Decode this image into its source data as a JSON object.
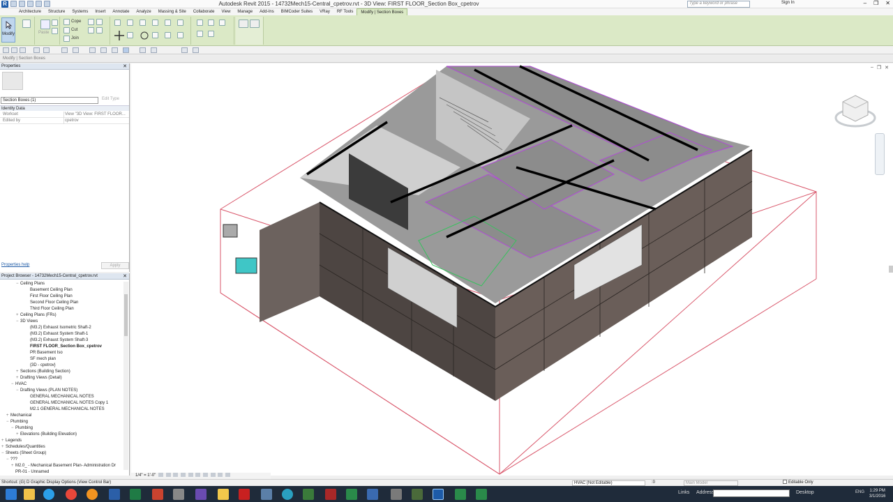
{
  "app": {
    "title": "Autodesk Revit 2015 -     14732Mech15-Central_cpetrov.rvt - 3D View: FIRST FLOOR_Section Box_cpetrov",
    "search_placeholder": "Type a keyword or phrase",
    "sign_in": "Sign In"
  },
  "ribbon": {
    "tabs": [
      "Architecture",
      "Structure",
      "Systems",
      "Insert",
      "Annotate",
      "Analyze",
      "Massing & Site",
      "Collaborate",
      "View",
      "Manage",
      "Add-Ins",
      "BIMCoder Suites",
      "VRay",
      "RF Tools",
      "Modify | Section Boxes"
    ],
    "active_tab": "Modify | Section Boxes",
    "modify_label": "Modify",
    "paste_label": "Paste",
    "cope_label": "Cope",
    "cut_label": "Cut",
    "join_label": "Join"
  },
  "context_bar": {
    "label": "Modify | Section Boxes"
  },
  "properties": {
    "header": "Properties",
    "selector": "Section Boxes (1)",
    "edit_type": "Edit Type",
    "group": "Identity Data",
    "rows": [
      {
        "key": "Workset",
        "value": "View \"3D View: FIRST FLOOR..."
      },
      {
        "key": "Edited by",
        "value": "cpetrov"
      }
    ],
    "help_link": "Properties help",
    "apply": "Apply"
  },
  "browser": {
    "header": "Project Browser - 14732Mech15-Central_cpetrov.rvt",
    "nodes": [
      {
        "label": "Ceiling Plans",
        "indent": 3,
        "toggle": "−"
      },
      {
        "label": "Basement Ceiling Plan",
        "indent": 5,
        "toggle": ""
      },
      {
        "label": "First Floor Ceiling Plan",
        "indent": 5,
        "toggle": ""
      },
      {
        "label": "Second Floor Ceiling Plan",
        "indent": 5,
        "toggle": ""
      },
      {
        "label": "Third Floor Ceiling Plan",
        "indent": 5,
        "toggle": ""
      },
      {
        "label": "Ceiling Plans (FRs)",
        "indent": 3,
        "toggle": "+"
      },
      {
        "label": "3D Views",
        "indent": 3,
        "toggle": "−"
      },
      {
        "label": "(M3.2) Exhaust Isometric Shaft-2",
        "indent": 5,
        "toggle": ""
      },
      {
        "label": "(M3.2) Exhaust System Shaft-1",
        "indent": 5,
        "toggle": ""
      },
      {
        "label": "(M3.2) Exhaust System Shaft-3",
        "indent": 5,
        "toggle": ""
      },
      {
        "label": "FIRST FLOOR_Section Box_cpetrov",
        "indent": 5,
        "toggle": "",
        "selected": true
      },
      {
        "label": "PR Basement Iso",
        "indent": 5,
        "toggle": ""
      },
      {
        "label": "SF mech plan",
        "indent": 5,
        "toggle": ""
      },
      {
        "label": "{3D - cpetrov}",
        "indent": 5,
        "toggle": ""
      },
      {
        "label": "Sections (Building Section)",
        "indent": 3,
        "toggle": "+"
      },
      {
        "label": "Drafting Views (Detail)",
        "indent": 3,
        "toggle": "+"
      },
      {
        "label": "HVAC",
        "indent": 2,
        "toggle": "−"
      },
      {
        "label": "Drafting Views (PLAN NOTES)",
        "indent": 3,
        "toggle": "−"
      },
      {
        "label": "GENERAL MECHANICAL NOTES",
        "indent": 5,
        "toggle": ""
      },
      {
        "label": "GENERAL MECHANICAL NOTES Copy 1",
        "indent": 5,
        "toggle": ""
      },
      {
        "label": "M2.1 GENERAL MECHANICAL NOTES",
        "indent": 5,
        "toggle": ""
      },
      {
        "label": "Mechanical",
        "indent": 1,
        "toggle": "+"
      },
      {
        "label": "Plumbing",
        "indent": 1,
        "toggle": "−"
      },
      {
        "label": "Plumbing",
        "indent": 2,
        "toggle": "−"
      },
      {
        "label": "Elevations (Building Elevation)",
        "indent": 3,
        "toggle": "+"
      },
      {
        "label": "Legends",
        "indent": 0,
        "toggle": "+"
      },
      {
        "label": "Schedules/Quantities",
        "indent": 0,
        "toggle": "+"
      },
      {
        "label": "Sheets (Sheet Group)",
        "indent": 0,
        "toggle": "−"
      },
      {
        "label": "???",
        "indent": 1,
        "toggle": "−"
      },
      {
        "label": "M2.0_ - Mechanical Basement Plan- Administration Dr",
        "indent": 2,
        "toggle": "+"
      },
      {
        "label": "PR-01 - Unnamed",
        "indent": 2,
        "toggle": ""
      }
    ]
  },
  "view_control": {
    "scale": "1/4\" = 1'-0\""
  },
  "status": {
    "text": "Shortcut: (G) D Graphic Display Options (View Control Bar)",
    "workset": "HVAC (Not Editable)",
    "workset_count": ":0",
    "design_option": "Main Model",
    "editable_only": "Editable Only"
  },
  "taskbar": {
    "links": "Links",
    "address": "Address",
    "desktop": "Desktop",
    "lang": "ENG",
    "time": "1:29 PM",
    "date": "3/1/2016"
  },
  "colors": {
    "ribbon_bg": "#dbe9c6",
    "section_box": "#d9576b",
    "ducts": "#b04bd6",
    "taskbar": "#1f2b3a"
  }
}
